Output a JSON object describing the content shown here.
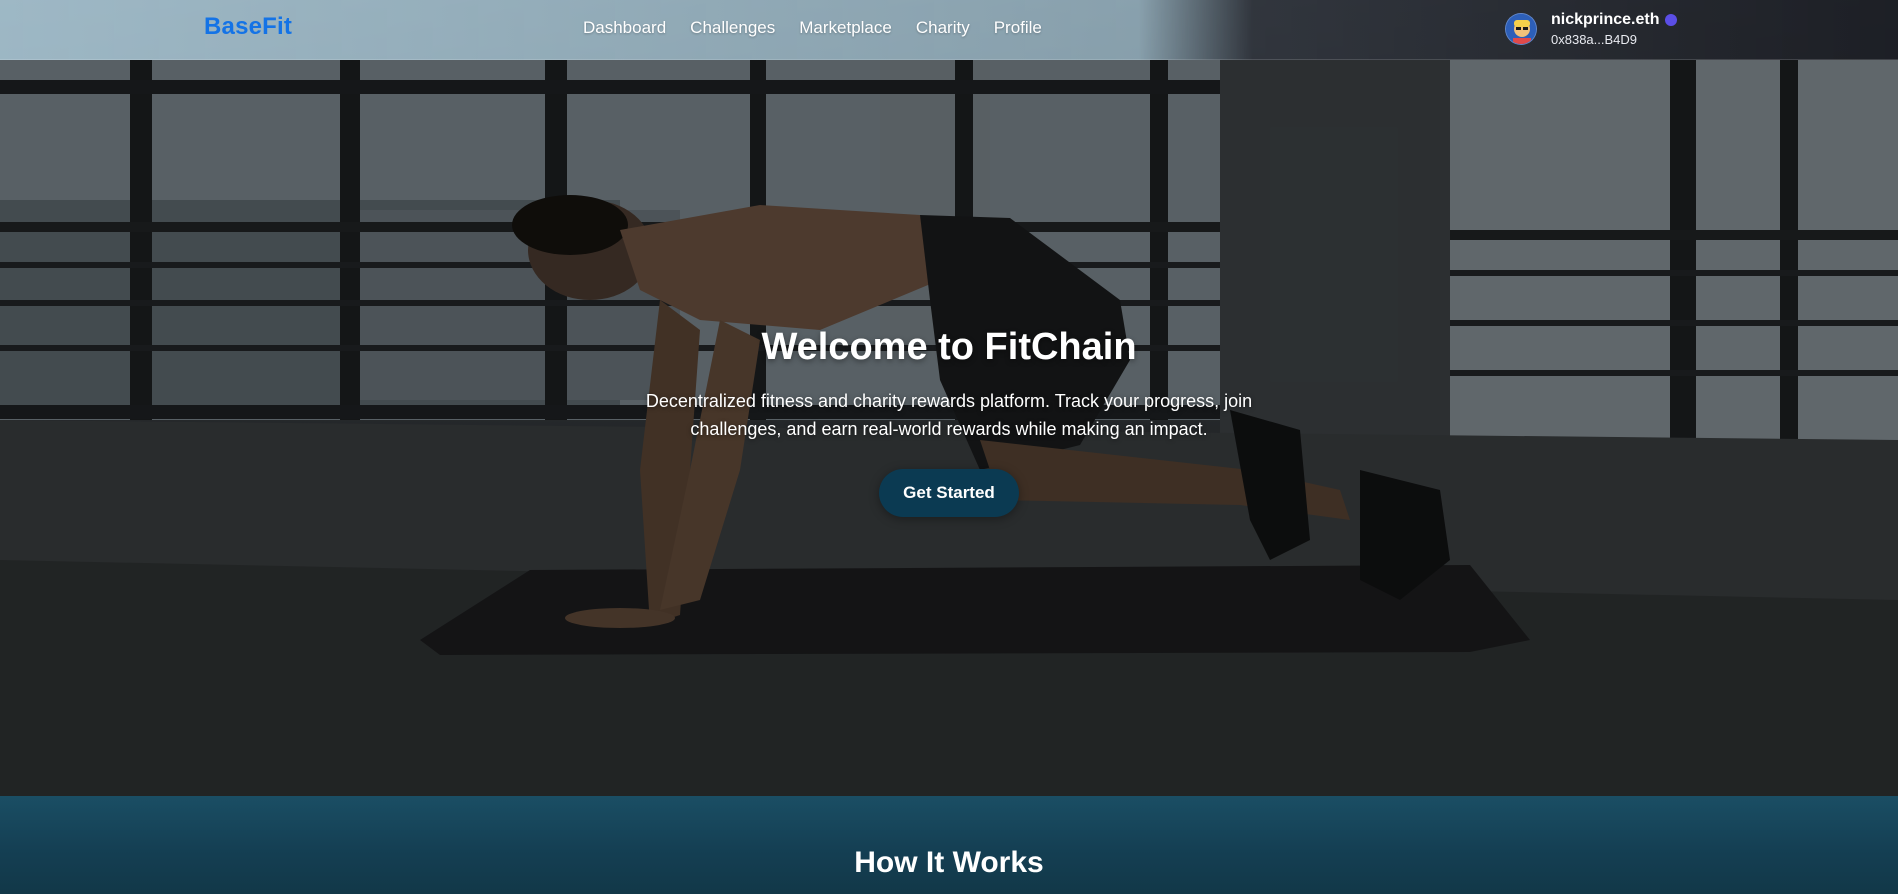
{
  "brand": {
    "name": "BaseFit",
    "color": "#1473e6"
  },
  "nav": {
    "items": [
      {
        "label": "Dashboard"
      },
      {
        "label": "Challenges"
      },
      {
        "label": "Marketplace"
      },
      {
        "label": "Charity"
      },
      {
        "label": "Profile"
      }
    ]
  },
  "profile": {
    "name": "nickprince.eth",
    "address": "0x838a...B4D9",
    "avatar_icon": "avatar-icon",
    "verified_icon": "verified-dot-icon",
    "verified_color": "#5b4ee6"
  },
  "hero": {
    "title": "Welcome to FitChain",
    "subtitle": "Decentralized fitness and charity rewards platform. Track your progress, join challenges, and earn real-world rewards while making an impact.",
    "cta_label": "Get Started",
    "cta_color": "#0b3a52"
  },
  "how_it_works": {
    "title": "How It Works",
    "background": "#1a4e64"
  }
}
